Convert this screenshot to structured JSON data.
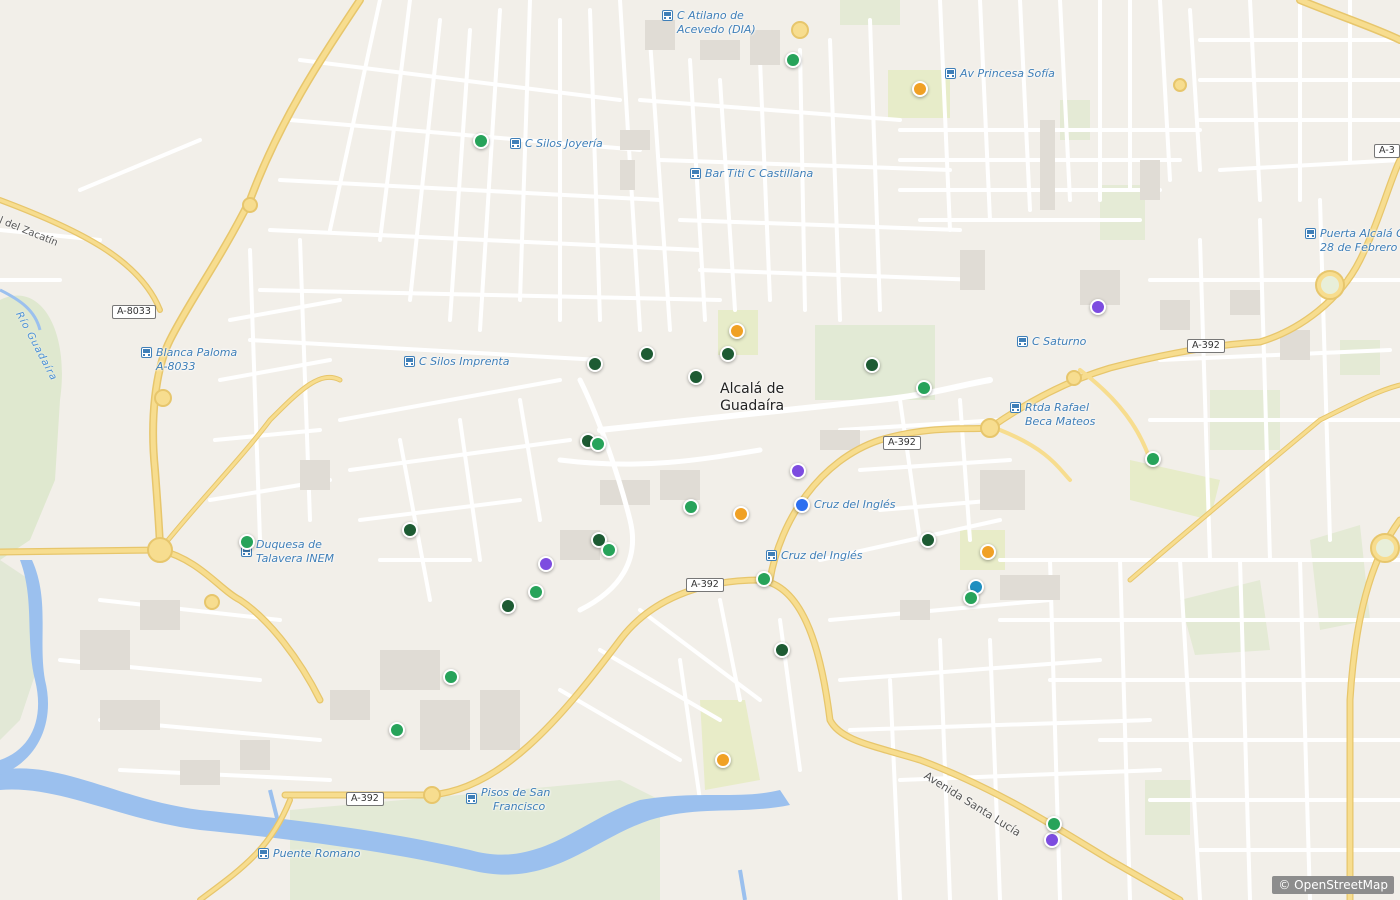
{
  "city": {
    "line1": "Alcalá de",
    "line2": "Guadaíra"
  },
  "stops": [
    {
      "id": "atilano",
      "lines": [
        "C Atilano de",
        "Acevedo (DIA)"
      ]
    },
    {
      "id": "princesa",
      "lines": [
        "Av Princesa Sofía"
      ]
    },
    {
      "id": "silos-joyeria",
      "lines": [
        "C Silos Joyería"
      ]
    },
    {
      "id": "bar-titi",
      "lines": [
        "Bar Titi C Castillana"
      ]
    },
    {
      "id": "puerta-alcala",
      "lines": [
        "Puerta Alcalá C",
        "28 de Febrero"
      ]
    },
    {
      "id": "blanca-paloma",
      "lines": [
        "Blanca Paloma",
        "A-8033"
      ]
    },
    {
      "id": "silos-imprenta",
      "lines": [
        "C Silos Imprenta"
      ]
    },
    {
      "id": "saturno",
      "lines": [
        "C Saturno"
      ]
    },
    {
      "id": "rafael-beca",
      "lines": [
        "Rtda Rafael",
        "Beca Mateos"
      ]
    },
    {
      "id": "duquesa",
      "lines": [
        "Duquesa de",
        "Talavera INEM"
      ]
    },
    {
      "id": "cruz-ingles-1",
      "lines": [
        "Cruz del Inglés"
      ]
    },
    {
      "id": "cruz-ingles-2",
      "lines": [
        "Cruz del Inglés"
      ]
    },
    {
      "id": "pisos-san-francisco",
      "lines": [
        "Pisos de San",
        "Francisco"
      ]
    },
    {
      "id": "puente-romano",
      "lines": [
        "Puente Romano"
      ]
    }
  ],
  "roads": {
    "zacatin": "al del Zacatín",
    "santa_lucia": "Avenida Santa Lucía",
    "a8033": "A-8033",
    "a392_1": "A-392",
    "a392_2": "A-392",
    "a392_3": "A-392",
    "a392_4": "A-392",
    "a392_5": "A-3"
  },
  "river": "Río Guadaíra",
  "attribution": "© OpenStreetMap",
  "marker_colors": {
    "green": "#27a35a",
    "dark_green": "#1d5b33",
    "orange": "#f0a125",
    "purple": "#7d4ce0",
    "blue": "#2d6ff0",
    "teal": "#1e8fc0"
  },
  "markers": [
    {
      "c": "green"
    },
    {
      "c": "orange"
    },
    {
      "c": "green"
    },
    {
      "c": "purple"
    },
    {
      "c": "orange"
    },
    {
      "c": "dark_green"
    },
    {
      "c": "dark_green"
    },
    {
      "c": "dark_green"
    },
    {
      "c": "dark_green"
    },
    {
      "c": "dark_green"
    },
    {
      "c": "green"
    },
    {
      "c": "dark_green"
    },
    {
      "c": "green"
    },
    {
      "c": "purple"
    },
    {
      "c": "blue"
    },
    {
      "c": "orange"
    },
    {
      "c": "green"
    },
    {
      "c": "dark_green"
    },
    {
      "c": "green"
    },
    {
      "c": "dark_green"
    },
    {
      "c": "orange"
    },
    {
      "c": "green"
    },
    {
      "c": "dark_green"
    },
    {
      "c": "teal"
    },
    {
      "c": "green"
    },
    {
      "c": "purple"
    },
    {
      "c": "green"
    },
    {
      "c": "dark_green"
    },
    {
      "c": "green"
    },
    {
      "c": "green"
    },
    {
      "c": "green"
    },
    {
      "c": "dark_green"
    },
    {
      "c": "orange"
    },
    {
      "c": "green"
    },
    {
      "c": "purple"
    },
    {
      "c": "green"
    }
  ]
}
